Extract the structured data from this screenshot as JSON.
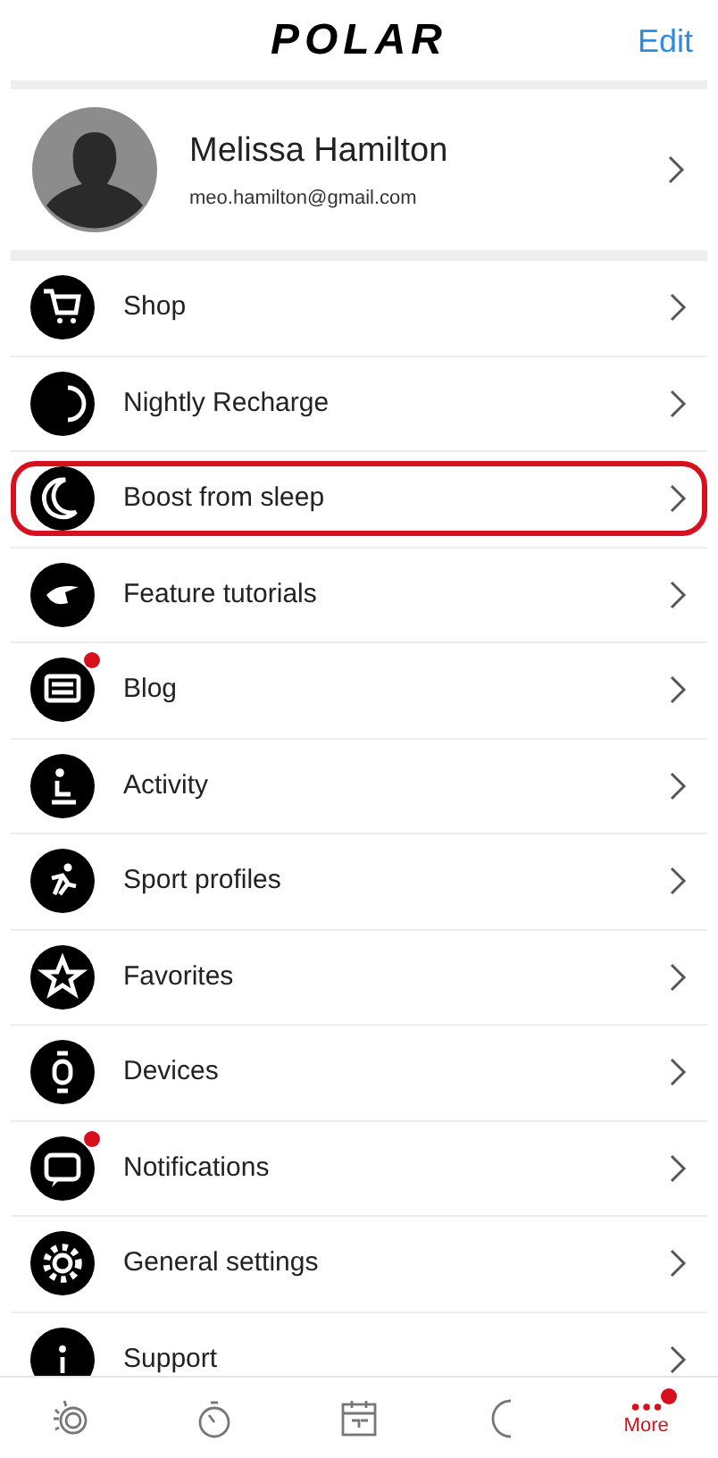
{
  "header": {
    "logo": "POLAR",
    "edit": "Edit"
  },
  "profile": {
    "name": "Melissa Hamilton",
    "email": "meo.hamilton@gmail.com"
  },
  "menu": [
    {
      "label": "Shop",
      "badge": false,
      "highlighted": false
    },
    {
      "label": "Nightly Recharge",
      "badge": false,
      "highlighted": false
    },
    {
      "label": "Boost from sleep",
      "badge": false,
      "highlighted": true
    },
    {
      "label": "Feature tutorials",
      "badge": false,
      "highlighted": false
    },
    {
      "label": "Blog",
      "badge": true,
      "highlighted": false
    },
    {
      "label": "Activity",
      "badge": false,
      "highlighted": false
    },
    {
      "label": "Sport profiles",
      "badge": false,
      "highlighted": false
    },
    {
      "label": "Favorites",
      "badge": false,
      "highlighted": false
    },
    {
      "label": "Devices",
      "badge": false,
      "highlighted": false
    },
    {
      "label": "Notifications",
      "badge": true,
      "highlighted": false
    },
    {
      "label": "General settings",
      "badge": false,
      "highlighted": false
    },
    {
      "label": "Support",
      "badge": false,
      "highlighted": false
    }
  ],
  "tab_bar": [
    {
      "selected": false,
      "badge": false
    },
    {
      "selected": false,
      "badge": false
    },
    {
      "selected": false,
      "badge": false
    },
    {
      "selected": false,
      "badge": false
    },
    {
      "label": "More",
      "selected": true,
      "badge": true
    }
  ]
}
